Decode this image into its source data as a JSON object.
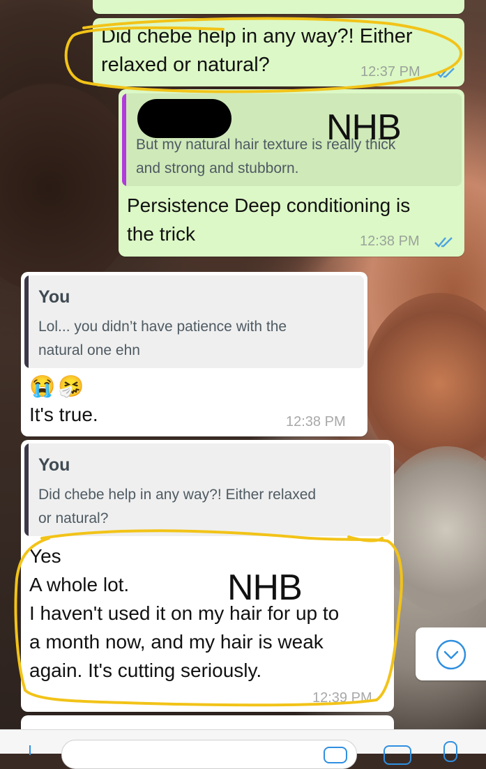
{
  "messages": [
    {
      "text_line1": "Did chebe help in any way?! Either",
      "text_line2": "relaxed or natural?",
      "time": "12:37 PM"
    },
    {
      "quote_text_line1": "But my natural hair texture is really thick",
      "quote_text_line2": "and strong and stubborn.",
      "text_line1": "Persistence Deep conditioning is",
      "text_line2": "the trick",
      "time": "12:38 PM"
    },
    {
      "quote_author": "You",
      "quote_text_line1": "Lol... you didn’t have patience with the",
      "quote_text_line2": "natural one ehn",
      "emojis": "😭🤧",
      "text_line1": "It's true.",
      "time": "12:38 PM"
    },
    {
      "quote_author": "You",
      "quote_text_line1": "Did chebe help in any way?! Either relaxed",
      "quote_text_line2": "or natural?",
      "lines": [
        "Yes",
        "A whole lot.",
        "I haven't used it on my hair for up to",
        "a month now, and my hair is weak",
        "again. It's cutting seriously."
      ],
      "time": "12:39 PM"
    }
  ],
  "watermarks": {
    "first": "NHB",
    "second": "NHB"
  },
  "colors": {
    "outgoing_bubble": "#dcf8c6",
    "incoming_bubble": "#ffffff",
    "quote_bar_purple": "#b13bdc",
    "quote_bar_dark": "#3d3848",
    "read_ticks": "#4fa3e0",
    "highlight_marker": "#f2c318",
    "redaction": "#000000"
  },
  "icons": {
    "read_ticks": "double-check-icon",
    "scroll_down": "chevron-down-circle-icon",
    "camera": "camera-icon",
    "mic": "mic-icon"
  }
}
